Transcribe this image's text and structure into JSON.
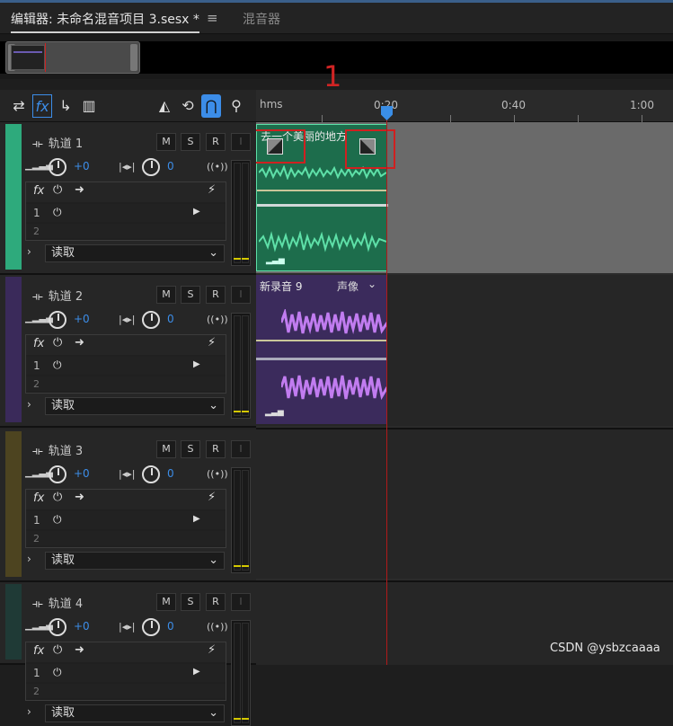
{
  "tabs": {
    "editor": "编辑器: 未命名混音项目 3.sesx *",
    "menu": "≡",
    "mixer": "混音器"
  },
  "marker": "1",
  "toolbar": {
    "swap": "⇄",
    "fx": "fx",
    "send": "↳",
    "eq": "▥",
    "metro": "◭",
    "loop": "⟲",
    "snap": "⋂",
    "pin": "⚲"
  },
  "ruler": {
    "unit": "hms",
    "labels": [
      "0:20",
      "0:40",
      "1:00"
    ]
  },
  "tracks": [
    {
      "name": "轨道 1",
      "color": "#2eaa7c",
      "vol": "+0",
      "pan": "0",
      "read": "读取"
    },
    {
      "name": "轨道 2",
      "color": "#3a2a5a",
      "vol": "+0",
      "pan": "0",
      "read": "读取"
    },
    {
      "name": "轨道 3",
      "color": "#4d4420",
      "vol": "+0",
      "pan": "0",
      "read": "读取"
    },
    {
      "name": "轨道 4",
      "color": "#1f3a36",
      "vol": "+0",
      "pan": "0",
      "read": "读取"
    }
  ],
  "buttons": {
    "m": "M",
    "s": "S",
    "r": "R",
    "i": "I"
  },
  "fx": {
    "label": "fx",
    "slot1": "1",
    "slot2": "2"
  },
  "clips": [
    {
      "title": "去一个美丽的地方",
      "color": "#1c6e4c",
      "wave": "#5ee0a8"
    },
    {
      "title": "新录音 9",
      "mode": "声像",
      "color": "#3c2a5c",
      "wave": "#c17cf0"
    }
  ],
  "watermark": "CSDN @ysbzcaaaa"
}
